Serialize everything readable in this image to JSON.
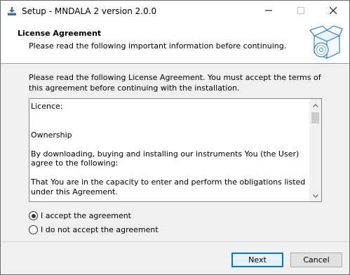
{
  "window": {
    "title": "Setup - MNDALA 2 version 2.0.0"
  },
  "header": {
    "title": "License Agreement",
    "subtitle": "Please read the following important information before continuing."
  },
  "intro": "Please read the following License Agreement. You must accept the terms of this agreement before continuing with the installation.",
  "license": {
    "paragraphs": [
      "Licence:",
      "",
      "Ownership",
      "By downloading, buying and installing our instruments You (the User) agree to the following:",
      "That You are in the capacity to enter and perform the obligations listed under this Agreement."
    ]
  },
  "options": {
    "accept": "I accept the agreement",
    "decline": "I do not accept the agreement",
    "selected": "accept"
  },
  "buttons": {
    "next": "Next",
    "cancel": "Cancel"
  },
  "icons": {
    "app": "setup-installer-icon",
    "header": "software-box-with-disc-icon",
    "minimize": "minimize-icon",
    "maximize": "maximize-icon",
    "close": "close-icon"
  },
  "colors": {
    "accent": "#0078d7"
  }
}
